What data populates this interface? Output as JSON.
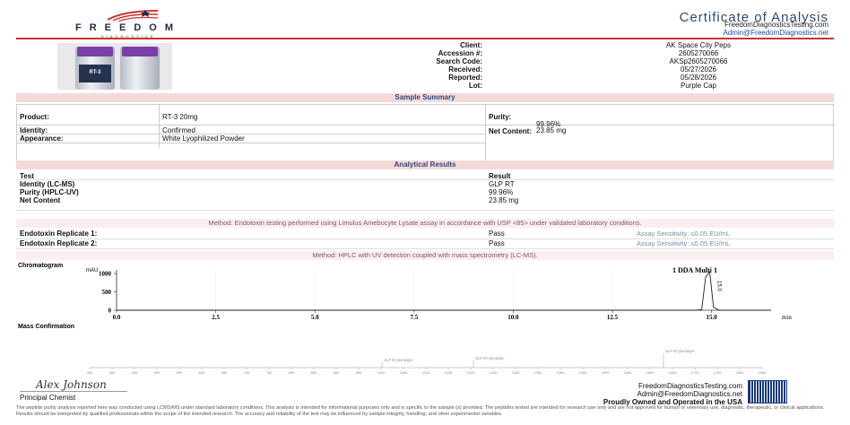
{
  "brand": {
    "word": "FREEDOM",
    "sub": "DIAGNOSTICS"
  },
  "header": {
    "title": "Certificate of Analysis",
    "website": "FreedomDiagnosticsTesting.com",
    "email": "Admin@FreedomDiagnostics.net"
  },
  "vial": {
    "label": "RT-3"
  },
  "client": [
    {
      "label": "Client:",
      "value": "AK Space City Peps"
    },
    {
      "label": "Accession #:",
      "value": "2605270066"
    },
    {
      "label": "Search Code:",
      "value": "AKSp2605270066"
    },
    {
      "label": "Received:",
      "value": "05/27/2026"
    },
    {
      "label": "Reported:",
      "value": "05/28/2026"
    },
    {
      "label": "Lot:",
      "value": "Purple Cap"
    }
  ],
  "sample_summary": {
    "title": "Sample Summary",
    "product_label": "Product:",
    "product_value": "RT-3 20mg",
    "identity_label": "Identity:",
    "identity_value": "Confirmed",
    "appearance_label": "Appearance:",
    "appearance_value": "White Lyophilized Powder",
    "purity_label": "Purity:",
    "purity_value": "99.96%",
    "net_label": "Net Content:",
    "net_value": "23.85 mg"
  },
  "analytical": {
    "title": "Analytical Results",
    "col_test": "Test",
    "col_result": "Result",
    "rows": [
      {
        "test": "Identity (LC-MS)",
        "result": "GLP RT"
      },
      {
        "test": "Purity (HPLC-UV)",
        "result": "99.96%"
      },
      {
        "test": "Net Content",
        "result": "23.85 mg"
      }
    ]
  },
  "endotoxin": {
    "method": "Method: Endotoxin testing performed using Limulus Amebocyte Lysate assay in accordance with USP <85> under validated laboratory conditions.",
    "rows": [
      {
        "label": "Endotoxin Replicate 1:",
        "result": "Pass",
        "sensitivity": "Assay Sensitivity: ≤0.05 EU/mL"
      },
      {
        "label": "Endotoxin Replicate 2:",
        "result": "Pass",
        "sensitivity": "Assay Sensitivity: ≤0.05 EU/mL"
      }
    ]
  },
  "hplc_method": "Method: HPLC with UV detection coupled with mass spectrometry (LC-MS).",
  "chromatogram": {
    "title": "Chromatogram",
    "unit": "mAU",
    "legend": "1 DDA Multi 1",
    "peak_label": "15.0",
    "y_ticks": [
      "1000",
      "500",
      "0"
    ],
    "x_ticks": [
      "0.0",
      "2.5",
      "5.0",
      "7.5",
      "10.0",
      "12.5",
      "15.0"
    ],
    "xlabel": "min",
    "chart_data": {
      "type": "line",
      "xlabel": "min",
      "ylabel": "mAU",
      "xlim": [
        0,
        16.5
      ],
      "ylim": [
        0,
        1100
      ],
      "x": [
        0,
        14.6,
        14.75,
        14.85,
        14.95,
        15.05,
        15.2,
        16.5
      ],
      "y": [
        0,
        0,
        20,
        900,
        1050,
        80,
        0,
        0
      ]
    }
  },
  "mass": {
    "title": "Mass Confirmation",
    "peak_labels": [
      "GLP RT [M+4H]4+",
      "GLP RT [M+3H]3+",
      "GLP RT [M+5H]5+"
    ],
    "x_ticks": [
      "350",
      "400",
      "450",
      "500",
      "550",
      "600",
      "650",
      "700",
      "750",
      "800",
      "850",
      "900",
      "950",
      "1000",
      "1050",
      "1100",
      "1150",
      "1200",
      "1250",
      "1300",
      "1350",
      "1400",
      "1450",
      "1500",
      "1550",
      "1600",
      "1650",
      "1700",
      "1750",
      "1800",
      "1850"
    ]
  },
  "footer": {
    "signature": "Alex Johnson",
    "role": "Principal Chemist",
    "website": "FreedomDiagnosticsTesting.com",
    "email": "Admin@FreedomDiagnostics.net",
    "owned": "Proudly Owned and Operated in the USA",
    "disclaimer": "The peptide purity analysis reported here was conducted using LCMS/MS under standard laboratory conditions. This analysis is intended for informational purposes only and is specific to the sample (s) provided. The peptides tested are intended for research use only and are not approved for human or veterinary use, diagnostic, therapeutic, or clinical applications. Results should be interpreted by qualified professionals within the scope of the intended research. The accuracy and reliability of the test may be influenced by sample integrity, handling, and other experimental variables."
  }
}
